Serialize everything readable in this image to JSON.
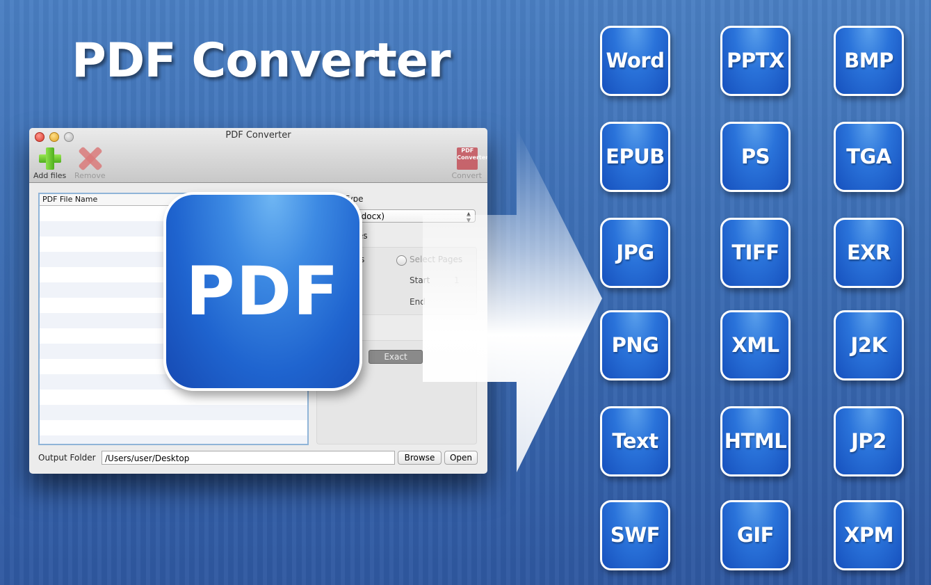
{
  "headline": "PDF Converter",
  "window": {
    "title": "PDF Converter",
    "toolbar": {
      "add_files": "Add files",
      "remove": "Remove",
      "convert": "Convert",
      "convert_icon_text": "PDF Converter"
    },
    "file_list": {
      "column_header": "PDF File Name",
      "rows": []
    },
    "output_type": {
      "label_fragment": "Type",
      "selected_fragment": "t Word (*.docx)"
    },
    "pages": {
      "label_fragment": "es",
      "all_pages_fragment": "ges",
      "select_pages_label": "Select Pages",
      "start_label": "Start",
      "start_value": "1",
      "end_label": "End"
    },
    "mode_segment": {
      "selected": "Exact"
    },
    "output_folder": {
      "label": "Output Folder",
      "value": "/Users/user/Desktop",
      "browse": "Browse",
      "open": "Open"
    }
  },
  "big_icon_text": "PDF",
  "formats": [
    [
      "Word",
      "PPTX",
      "BMP"
    ],
    [
      "EPUB",
      "PS",
      "TGA"
    ],
    [
      "JPG",
      "TIFF",
      "EXR"
    ],
    [
      "PNG",
      "XML",
      "J2K"
    ],
    [
      "Text",
      "HTML",
      "JP2"
    ],
    [
      "SWF",
      "GIF",
      "XPM"
    ]
  ]
}
